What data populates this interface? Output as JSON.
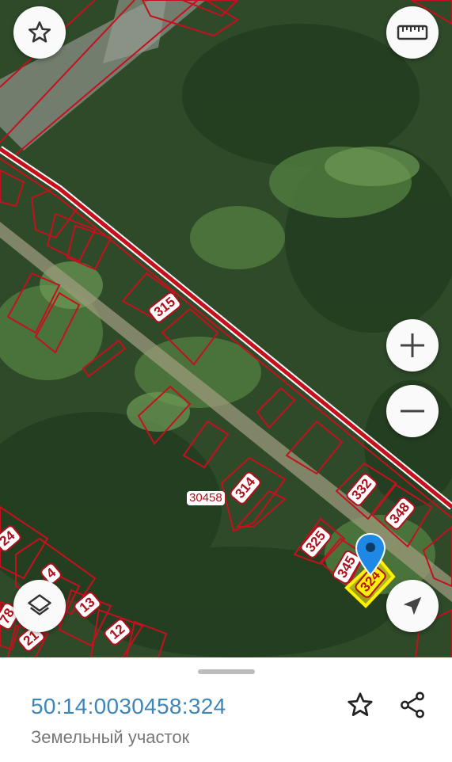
{
  "map": {
    "block_label": "30458",
    "plot_labels": [
      "315",
      "314",
      "332",
      "348",
      "325",
      "345",
      "324",
      "12",
      "13",
      "4",
      "24",
      "78",
      "21"
    ],
    "selected_plot": "324",
    "colors": {
      "boundary": "#c5101d",
      "selected_fill": "#fff200",
      "marker": "#1e88e5"
    }
  },
  "controls": {
    "favorite_icon": "star-outline-icon",
    "ruler_icon": "ruler-icon",
    "zoom_in_icon": "plus-icon",
    "zoom_out_icon": "minus-icon",
    "layers_icon": "layers-icon",
    "location_icon": "navigation-arrow-icon"
  },
  "sheet": {
    "cadastral_number": "50:14:0030458:324",
    "object_type": "Земельный участок",
    "favorite_icon": "star-outline-icon",
    "share_icon": "share-icon"
  }
}
